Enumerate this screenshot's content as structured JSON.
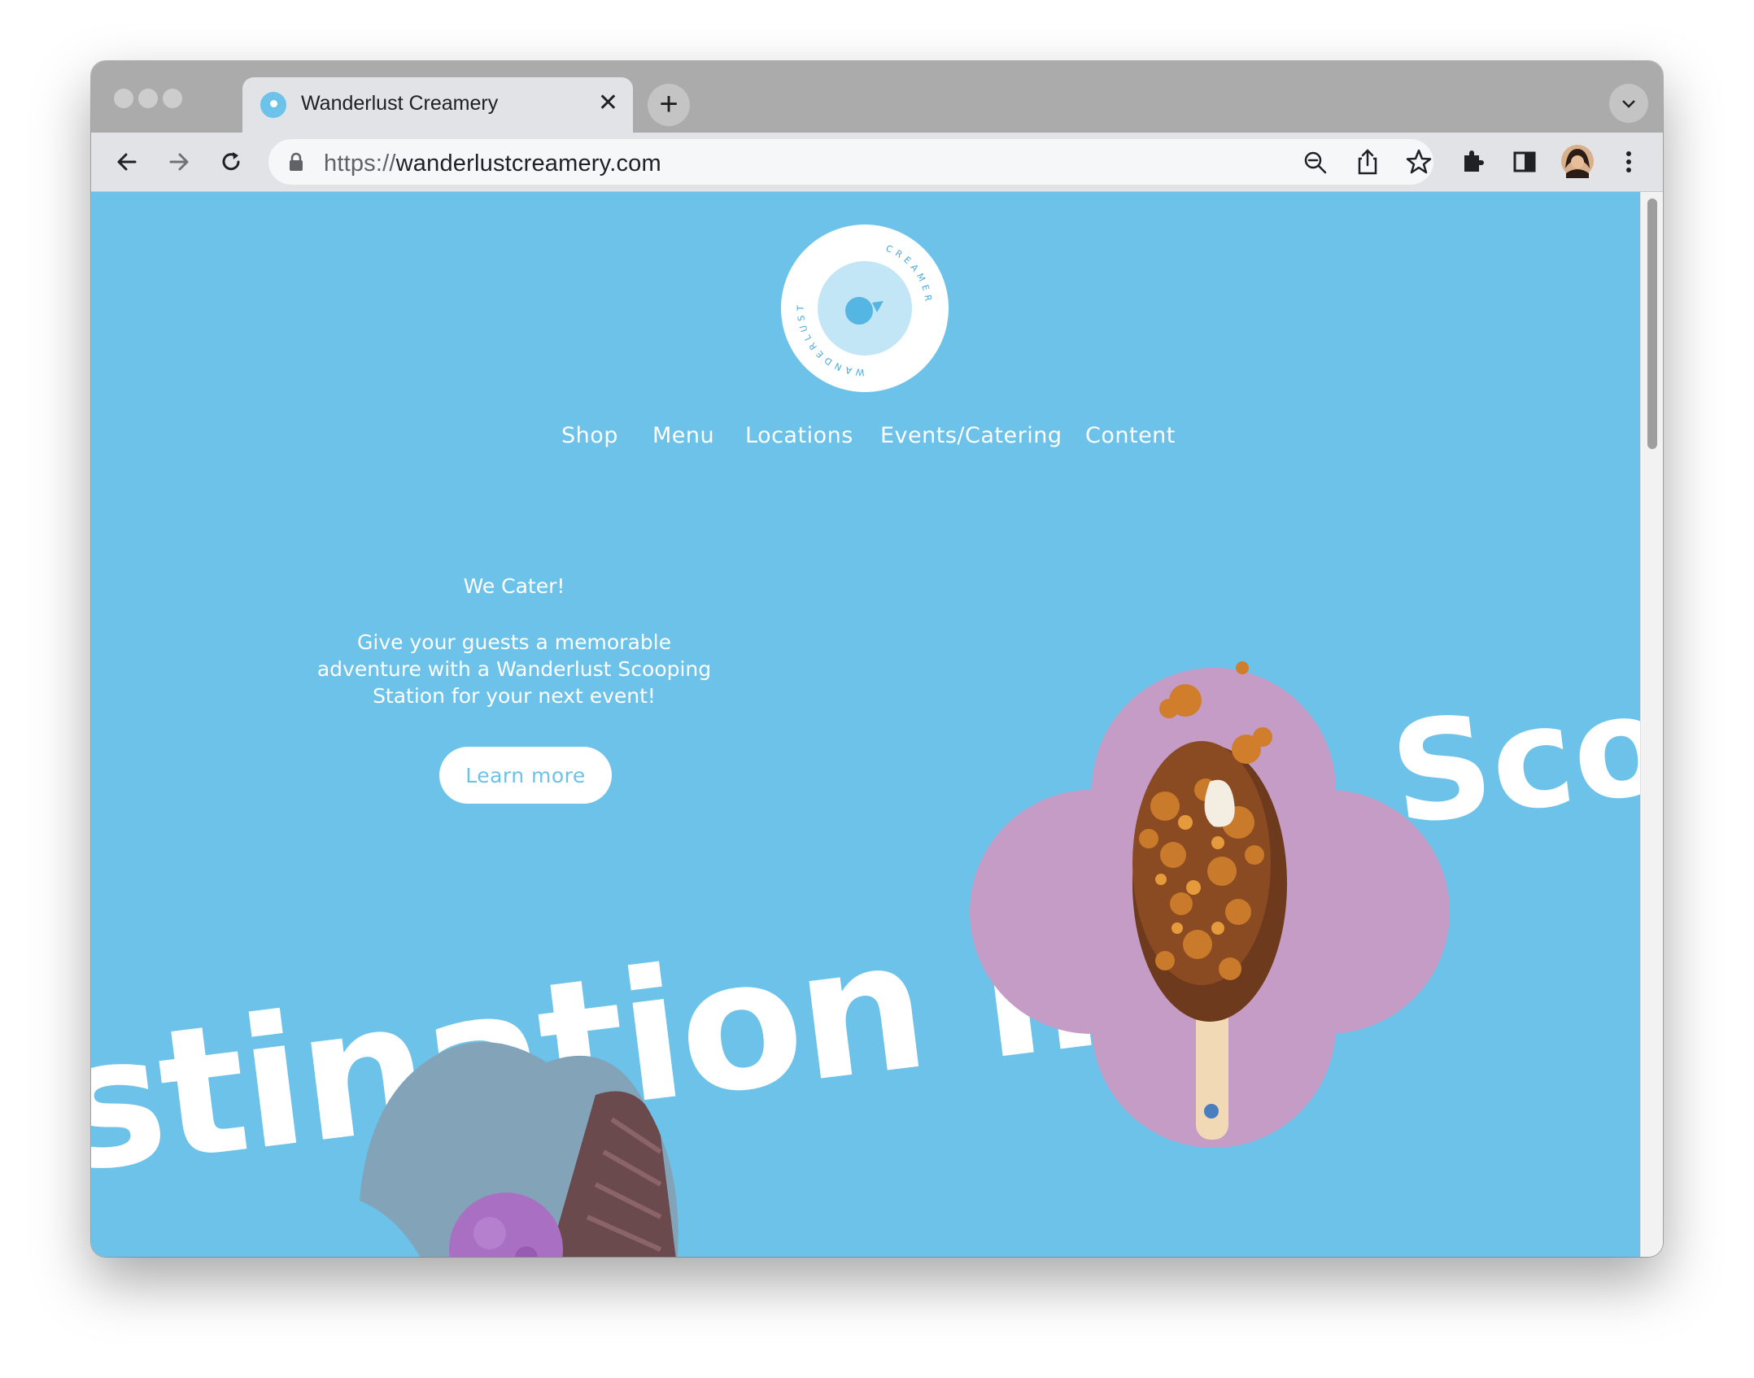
{
  "browser": {
    "tab_title": "Wanderlust Creamery",
    "close_glyph": "✕",
    "new_tab_glyph": "+",
    "url_scheme": "https://",
    "url_host": "wanderlustcreamery.com",
    "icons": [
      "back-icon",
      "forward-icon",
      "reload-icon",
      "lock-icon",
      "zoom-icon",
      "share-icon",
      "bookmark-star-icon",
      "extensions-icon",
      "side-panel-icon",
      "profile-avatar",
      "more-menu-icon",
      "tab-list-chevron-icon"
    ]
  },
  "site": {
    "logo_ring_left": "WANDERLUST",
    "logo_ring_right": "CREAMERY",
    "nav": [
      "Shop",
      "Menu",
      "Locations",
      "Events/Catering",
      "Content"
    ],
    "promo": {
      "title": "We Cater!",
      "text": "Give your guests a memorable adventure with a Wanderlust Scooping Station for your next event!",
      "button": "Learn more"
    },
    "marquee": "stination in E",
    "marquee_right": "Sco",
    "colors": {
      "background": "#6cc2e9",
      "flower": "#c59cc5",
      "text": "#ffffff"
    }
  }
}
